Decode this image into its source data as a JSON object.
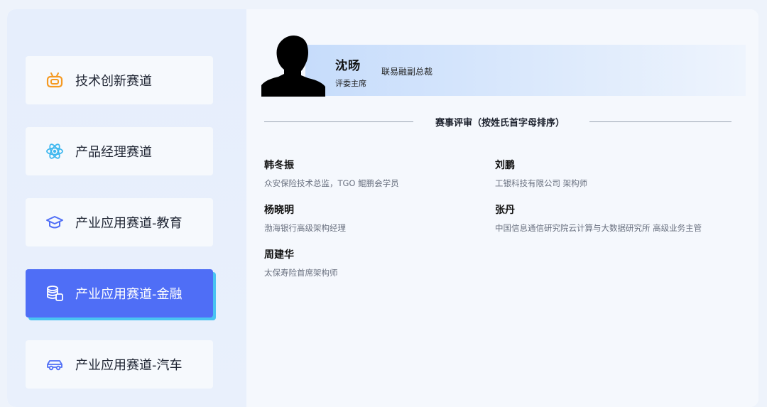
{
  "nav": {
    "items": [
      {
        "label": "技术创新赛道",
        "icon": "robot-icon",
        "active": false
      },
      {
        "label": "产品经理赛道",
        "icon": "atom-icon",
        "active": false
      },
      {
        "label": "产业应用赛道-教育",
        "icon": "graduation-cap-icon",
        "active": false
      },
      {
        "label": "产业应用赛道-金融",
        "icon": "coins-stack-icon",
        "active": true
      },
      {
        "label": "产业应用赛道-汽车",
        "icon": "car-icon",
        "active": false
      }
    ]
  },
  "chair": {
    "name": "沈旸",
    "role": "评委主席",
    "title": "联易融副总裁"
  },
  "judges_section": {
    "heading": "赛事评审（按姓氏首字母排序）",
    "judges": [
      {
        "name": "韩冬振",
        "desc": "众安保险技术总监，TGO 鲲鹏会学员"
      },
      {
        "name": "刘鹏",
        "desc": "工银科技有限公司 架构师"
      },
      {
        "name": "杨晓明",
        "desc": "渤海银行高级架构经理"
      },
      {
        "name": "张丹",
        "desc": "中国信息通信研究院云计算与大数据研究所 高级业务主管"
      },
      {
        "name": "周建华",
        "desc": "太保寿险首席架构师"
      }
    ]
  },
  "colors": {
    "active_bg": "#4f6ef6",
    "active_shadow": "#49c3f2",
    "icon_orange": "#f59a23",
    "icon_cyan": "#3fb8ef",
    "icon_blue": "#4f6ef6"
  }
}
